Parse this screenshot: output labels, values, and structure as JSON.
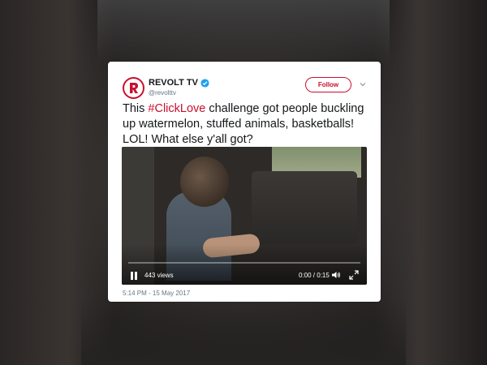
{
  "tweet": {
    "account_name": "REVOLT TV",
    "handle": "@revolttv",
    "follow_label": "Follow",
    "text_before": "This ",
    "hashtag": "#ClickLove",
    "text_after": " challenge got people buckling up watermelon, stuffed animals, basketballs! LOL! What else y'all got?",
    "timestamp": "5:14 PM - 15 May 2017"
  },
  "video": {
    "views": "443 views",
    "time": "0:00 / 0:15",
    "progress": 0
  },
  "colors": {
    "brand": "#c8102e",
    "verified": "#1da1f2",
    "text": "#14171a",
    "muted": "#657786"
  },
  "icons": {
    "avatar": "revolt-logo-icon",
    "verified": "verified-badge-icon",
    "menu": "chevron-down-icon",
    "play_pause": "pause-icon",
    "volume": "volume-icon",
    "fullscreen": "fullscreen-icon"
  }
}
